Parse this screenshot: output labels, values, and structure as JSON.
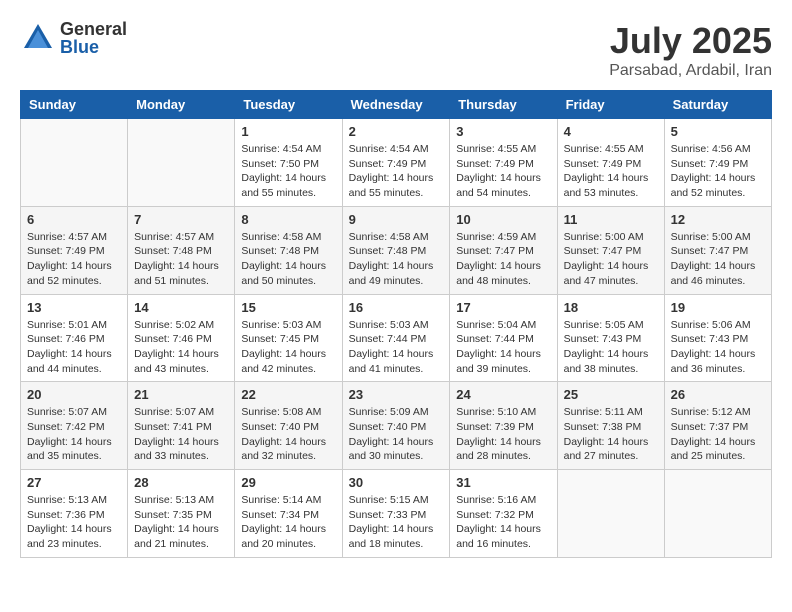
{
  "header": {
    "logo_general": "General",
    "logo_blue": "Blue",
    "month_title": "July 2025",
    "location": "Parsabad, Ardabil, Iran"
  },
  "days_of_week": [
    "Sunday",
    "Monday",
    "Tuesday",
    "Wednesday",
    "Thursday",
    "Friday",
    "Saturday"
  ],
  "weeks": [
    [
      {
        "day": "",
        "info": ""
      },
      {
        "day": "",
        "info": ""
      },
      {
        "day": "1",
        "info": "Sunrise: 4:54 AM\nSunset: 7:50 PM\nDaylight: 14 hours and 55 minutes."
      },
      {
        "day": "2",
        "info": "Sunrise: 4:54 AM\nSunset: 7:49 PM\nDaylight: 14 hours and 55 minutes."
      },
      {
        "day": "3",
        "info": "Sunrise: 4:55 AM\nSunset: 7:49 PM\nDaylight: 14 hours and 54 minutes."
      },
      {
        "day": "4",
        "info": "Sunrise: 4:55 AM\nSunset: 7:49 PM\nDaylight: 14 hours and 53 minutes."
      },
      {
        "day": "5",
        "info": "Sunrise: 4:56 AM\nSunset: 7:49 PM\nDaylight: 14 hours and 52 minutes."
      }
    ],
    [
      {
        "day": "6",
        "info": "Sunrise: 4:57 AM\nSunset: 7:49 PM\nDaylight: 14 hours and 52 minutes."
      },
      {
        "day": "7",
        "info": "Sunrise: 4:57 AM\nSunset: 7:48 PM\nDaylight: 14 hours and 51 minutes."
      },
      {
        "day": "8",
        "info": "Sunrise: 4:58 AM\nSunset: 7:48 PM\nDaylight: 14 hours and 50 minutes."
      },
      {
        "day": "9",
        "info": "Sunrise: 4:58 AM\nSunset: 7:48 PM\nDaylight: 14 hours and 49 minutes."
      },
      {
        "day": "10",
        "info": "Sunrise: 4:59 AM\nSunset: 7:47 PM\nDaylight: 14 hours and 48 minutes."
      },
      {
        "day": "11",
        "info": "Sunrise: 5:00 AM\nSunset: 7:47 PM\nDaylight: 14 hours and 47 minutes."
      },
      {
        "day": "12",
        "info": "Sunrise: 5:00 AM\nSunset: 7:47 PM\nDaylight: 14 hours and 46 minutes."
      }
    ],
    [
      {
        "day": "13",
        "info": "Sunrise: 5:01 AM\nSunset: 7:46 PM\nDaylight: 14 hours and 44 minutes."
      },
      {
        "day": "14",
        "info": "Sunrise: 5:02 AM\nSunset: 7:46 PM\nDaylight: 14 hours and 43 minutes."
      },
      {
        "day": "15",
        "info": "Sunrise: 5:03 AM\nSunset: 7:45 PM\nDaylight: 14 hours and 42 minutes."
      },
      {
        "day": "16",
        "info": "Sunrise: 5:03 AM\nSunset: 7:44 PM\nDaylight: 14 hours and 41 minutes."
      },
      {
        "day": "17",
        "info": "Sunrise: 5:04 AM\nSunset: 7:44 PM\nDaylight: 14 hours and 39 minutes."
      },
      {
        "day": "18",
        "info": "Sunrise: 5:05 AM\nSunset: 7:43 PM\nDaylight: 14 hours and 38 minutes."
      },
      {
        "day": "19",
        "info": "Sunrise: 5:06 AM\nSunset: 7:43 PM\nDaylight: 14 hours and 36 minutes."
      }
    ],
    [
      {
        "day": "20",
        "info": "Sunrise: 5:07 AM\nSunset: 7:42 PM\nDaylight: 14 hours and 35 minutes."
      },
      {
        "day": "21",
        "info": "Sunrise: 5:07 AM\nSunset: 7:41 PM\nDaylight: 14 hours and 33 minutes."
      },
      {
        "day": "22",
        "info": "Sunrise: 5:08 AM\nSunset: 7:40 PM\nDaylight: 14 hours and 32 minutes."
      },
      {
        "day": "23",
        "info": "Sunrise: 5:09 AM\nSunset: 7:40 PM\nDaylight: 14 hours and 30 minutes."
      },
      {
        "day": "24",
        "info": "Sunrise: 5:10 AM\nSunset: 7:39 PM\nDaylight: 14 hours and 28 minutes."
      },
      {
        "day": "25",
        "info": "Sunrise: 5:11 AM\nSunset: 7:38 PM\nDaylight: 14 hours and 27 minutes."
      },
      {
        "day": "26",
        "info": "Sunrise: 5:12 AM\nSunset: 7:37 PM\nDaylight: 14 hours and 25 minutes."
      }
    ],
    [
      {
        "day": "27",
        "info": "Sunrise: 5:13 AM\nSunset: 7:36 PM\nDaylight: 14 hours and 23 minutes."
      },
      {
        "day": "28",
        "info": "Sunrise: 5:13 AM\nSunset: 7:35 PM\nDaylight: 14 hours and 21 minutes."
      },
      {
        "day": "29",
        "info": "Sunrise: 5:14 AM\nSunset: 7:34 PM\nDaylight: 14 hours and 20 minutes."
      },
      {
        "day": "30",
        "info": "Sunrise: 5:15 AM\nSunset: 7:33 PM\nDaylight: 14 hours and 18 minutes."
      },
      {
        "day": "31",
        "info": "Sunrise: 5:16 AM\nSunset: 7:32 PM\nDaylight: 14 hours and 16 minutes."
      },
      {
        "day": "",
        "info": ""
      },
      {
        "day": "",
        "info": ""
      }
    ]
  ]
}
